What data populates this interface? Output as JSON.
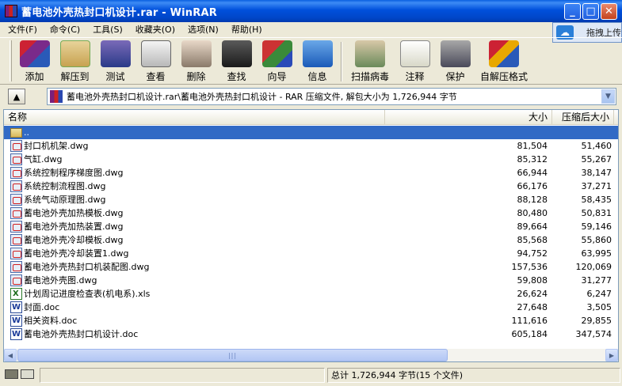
{
  "window": {
    "title": "蓄电池外壳热封口机设计.rar - WinRAR",
    "minimize": "_",
    "maximize": "□",
    "close": "✕"
  },
  "menu": [
    "文件(F)",
    "命令(C)",
    "工具(S)",
    "收藏夹(O)",
    "选项(N)",
    "帮助(H)"
  ],
  "ad_popup": {
    "text": "拖拽上传"
  },
  "toolbar": [
    {
      "label": "添加",
      "icon": "add-archive-icon"
    },
    {
      "label": "解压到",
      "icon": "extract-to-icon"
    },
    {
      "label": "测试",
      "icon": "test-icon"
    },
    {
      "label": "查看",
      "icon": "view-icon"
    },
    {
      "label": "删除",
      "icon": "delete-icon"
    },
    {
      "label": "查找",
      "icon": "find-binoculars-icon"
    },
    {
      "label": "向导",
      "icon": "wizard-icon"
    },
    {
      "label": "信息",
      "icon": "info-icon"
    },
    {
      "label": "扫描病毒",
      "icon": "virus-scan-icon"
    },
    {
      "label": "注释",
      "icon": "comment-icon"
    },
    {
      "label": "保护",
      "icon": "protect-shield-icon"
    },
    {
      "label": "自解压格式",
      "icon": "sfx-icon"
    }
  ],
  "address": {
    "path": "蓄电池外壳热封口机设计.rar\\蓄电池外壳热封口机设计 - RAR 压缩文件, 解包大小为 1,726,944 字节"
  },
  "columns": {
    "name": "名称",
    "size": "大小",
    "packed": "压缩后大小"
  },
  "files": [
    {
      "name": "..",
      "size": "",
      "packed": "",
      "type": "folder",
      "selected": true
    },
    {
      "name": "封口机机架.dwg",
      "size": "81,504",
      "packed": "51,460",
      "type": "dwg"
    },
    {
      "name": "气缸.dwg",
      "size": "85,312",
      "packed": "55,267",
      "type": "dwg"
    },
    {
      "name": "系统控制程序梯度图.dwg",
      "size": "66,944",
      "packed": "38,147",
      "type": "dwg"
    },
    {
      "name": "系统控制流程图.dwg",
      "size": "66,176",
      "packed": "37,271",
      "type": "dwg"
    },
    {
      "name": "系统气动原理图.dwg",
      "size": "88,128",
      "packed": "58,435",
      "type": "dwg"
    },
    {
      "name": "蓄电池外壳加热模板.dwg",
      "size": "80,480",
      "packed": "50,831",
      "type": "dwg"
    },
    {
      "name": "蓄电池外壳加热装置.dwg",
      "size": "89,664",
      "packed": "59,146",
      "type": "dwg"
    },
    {
      "name": "蓄电池外壳冷却模板.dwg",
      "size": "85,568",
      "packed": "55,860",
      "type": "dwg"
    },
    {
      "name": "蓄电池外壳冷却装置1.dwg",
      "size": "94,752",
      "packed": "63,995",
      "type": "dwg"
    },
    {
      "name": "蓄电池外壳热封口机装配图.dwg",
      "size": "157,536",
      "packed": "120,069",
      "type": "dwg"
    },
    {
      "name": "蓄电池外壳图.dwg",
      "size": "59,808",
      "packed": "31,277",
      "type": "dwg"
    },
    {
      "name": "计划周记进度检查表(机电系).xls",
      "size": "26,624",
      "packed": "6,247",
      "type": "xls"
    },
    {
      "name": "封面.doc",
      "size": "27,648",
      "packed": "3,505",
      "type": "doc"
    },
    {
      "name": "相关资料.doc",
      "size": "111,616",
      "packed": "29,855",
      "type": "doc"
    },
    {
      "name": "蓄电池外壳热封口机设计.doc",
      "size": "605,184",
      "packed": "347,574",
      "type": "doc"
    }
  ],
  "status": {
    "total": "总计 1,726,944 字节(15 个文件)"
  }
}
